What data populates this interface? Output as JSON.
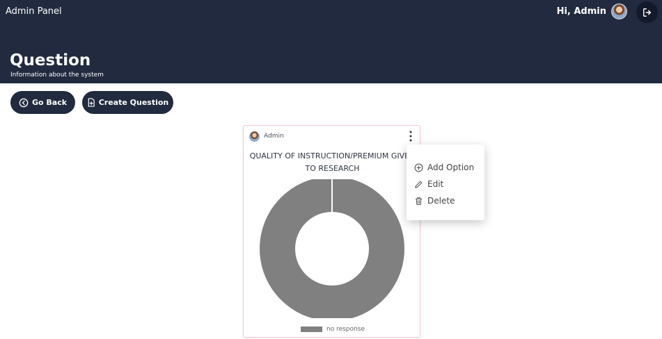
{
  "header": {
    "app_title": "Admin Panel",
    "greeting": "Hi, Admin",
    "page_title": "Question",
    "page_subtitle": "Information about the system"
  },
  "toolbar": {
    "back_label": "Go Back",
    "create_label": "Create Question"
  },
  "card": {
    "author": "Admin",
    "question": "QUALITY OF INSTRUCTION/PREMIUM GIVEN\nTO RESEARCH",
    "chart_data": {
      "type": "pie",
      "categories": [
        "no response"
      ],
      "values": [
        1
      ],
      "legend": [
        "no response"
      ],
      "legend_position": "bottom",
      "colors": [
        "#808080"
      ]
    }
  },
  "menu": {
    "items": [
      {
        "label": "Add Option",
        "icon": "plus-circle-icon"
      },
      {
        "label": "Edit",
        "icon": "pencil-icon"
      },
      {
        "label": "Delete",
        "icon": "trash-icon"
      }
    ]
  },
  "colors": {
    "header_bg": "#212a3e",
    "button_bg": "#212a3e",
    "chart_fill": "#808080"
  }
}
